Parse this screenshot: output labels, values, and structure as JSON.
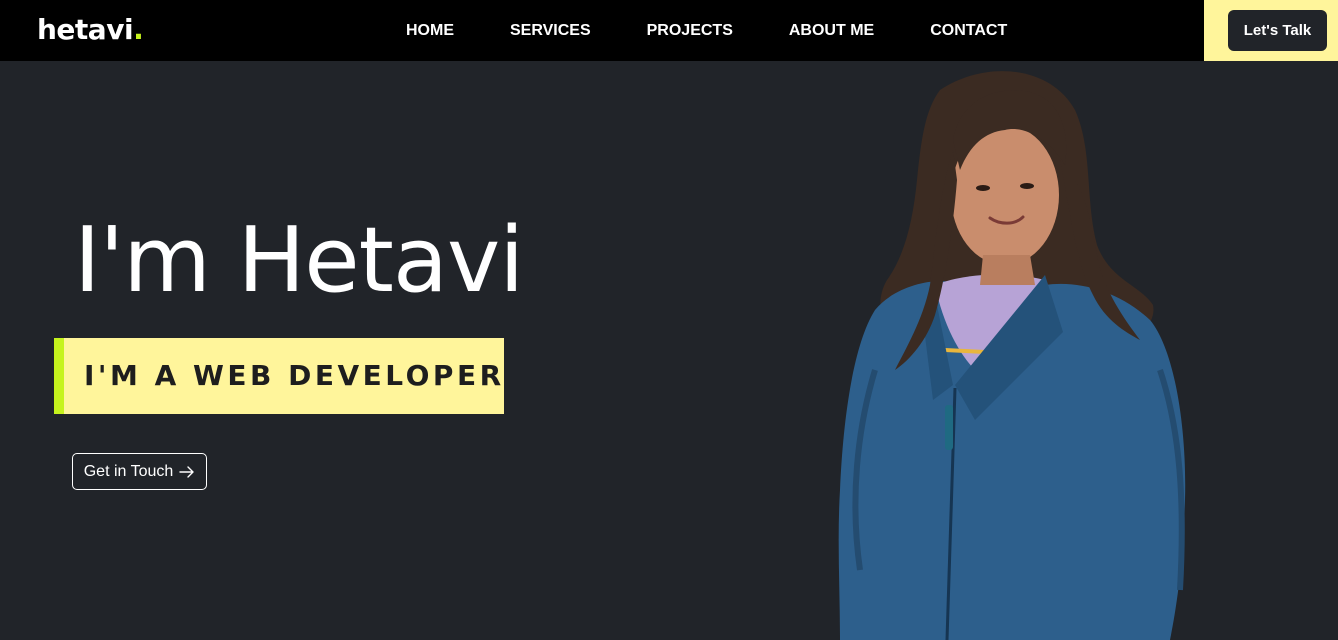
{
  "brand": {
    "name": "hetavi",
    "dot": "."
  },
  "nav": {
    "links": [
      "HOME",
      "SERVICES",
      "PROJECTS",
      "ABOUT ME",
      "CONTACT"
    ],
    "cta_label": "Let's Talk"
  },
  "hero": {
    "title": "I'm Hetavi",
    "role": "I'M A WEB DEVELOPER",
    "cta_label": "Get in Touch",
    "cta_icon": "arrow-right-icon"
  },
  "colors": {
    "background": "#212429",
    "navbar": "#000000",
    "accent_yellow": "#fff59b",
    "accent_green": "#c6f31d"
  }
}
